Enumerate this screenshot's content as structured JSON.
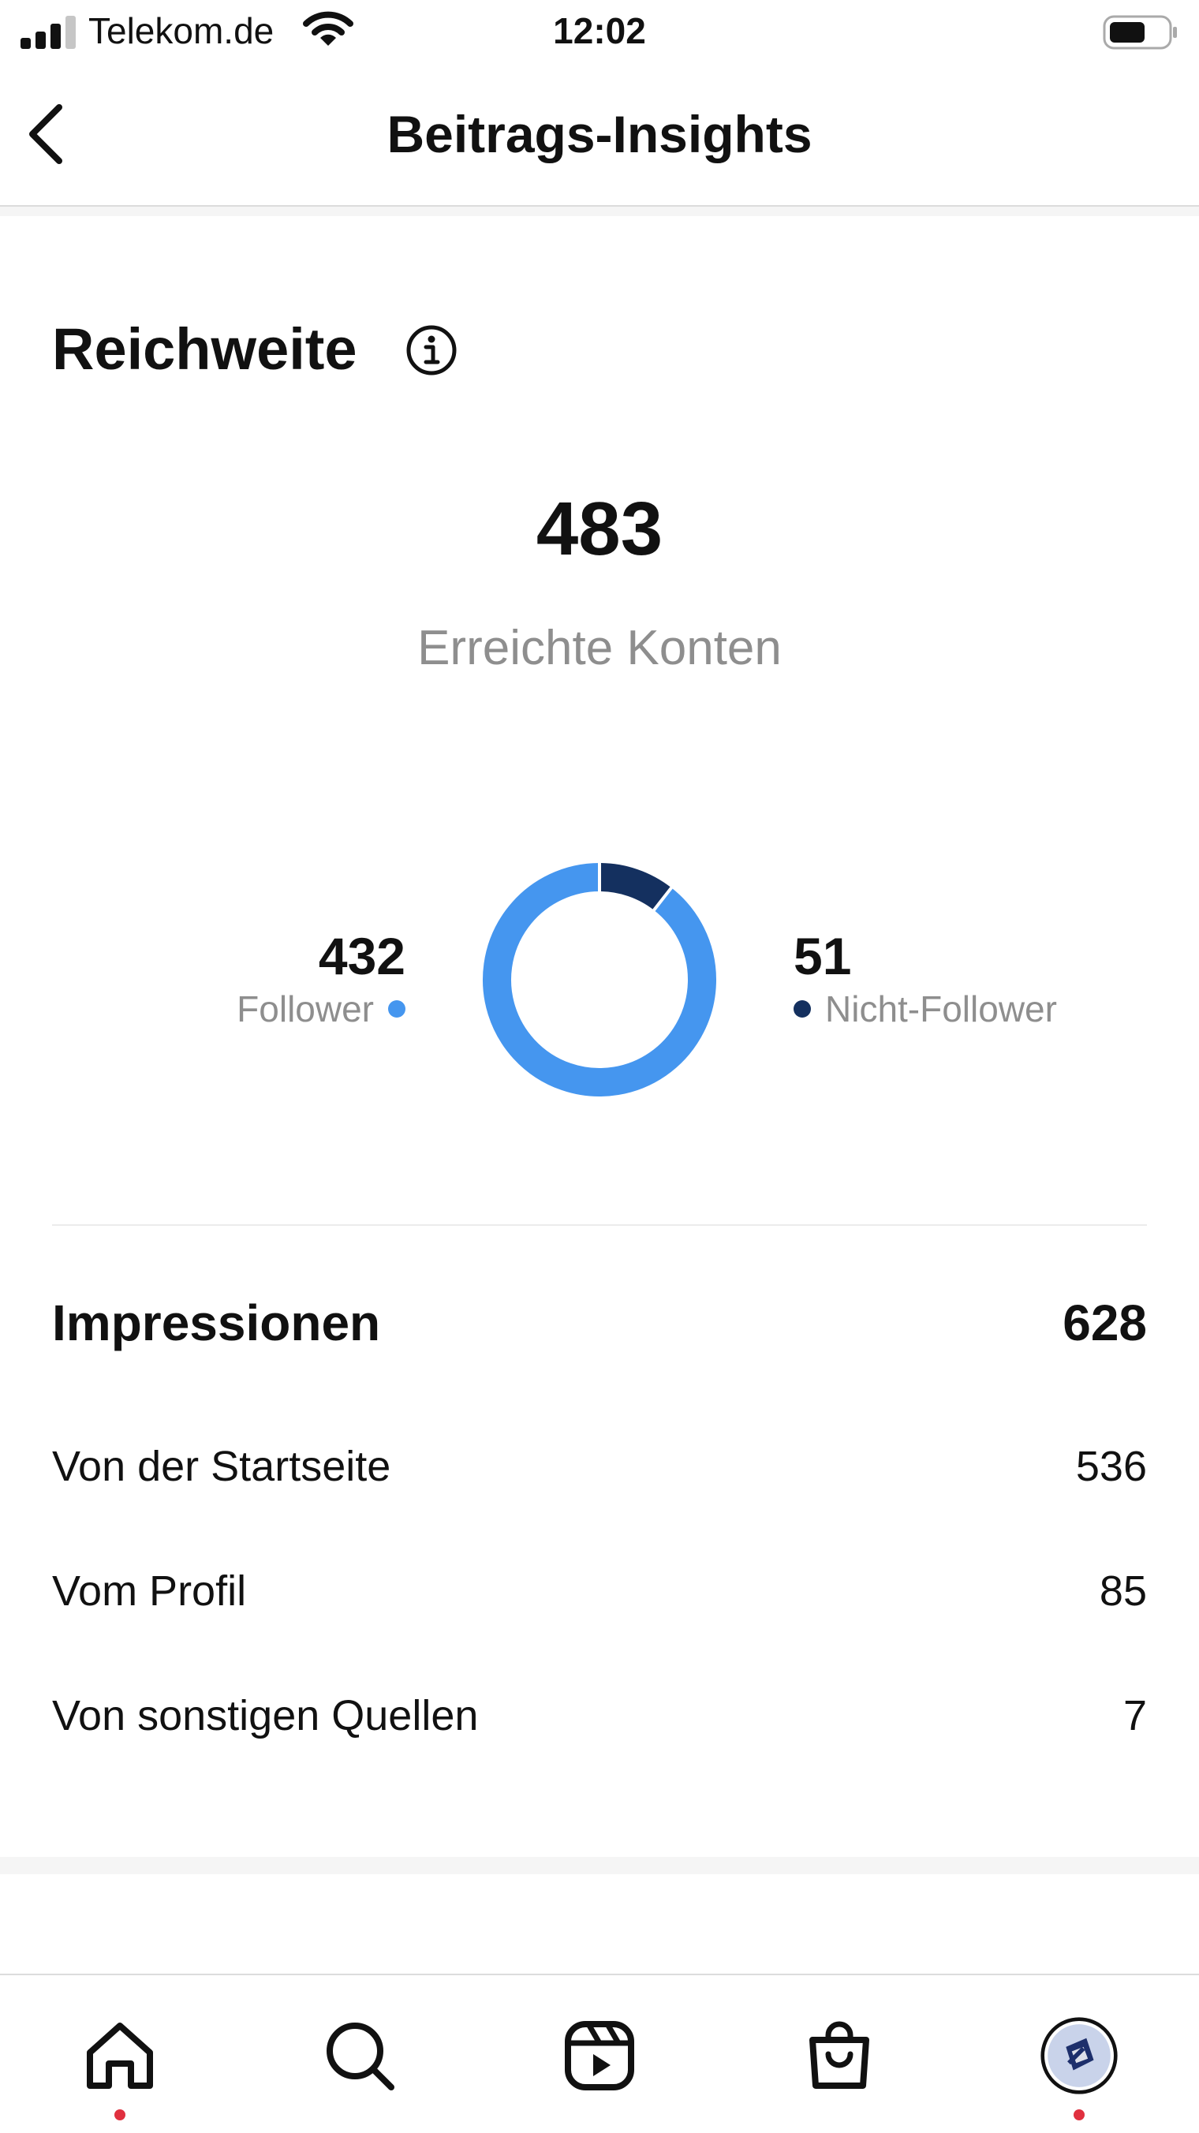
{
  "status_bar": {
    "carrier": "Telekom.de",
    "time": "12:02"
  },
  "header": {
    "title": "Beitrags-Insights"
  },
  "reach": {
    "title": "Reichweite",
    "accounts_reached": "483",
    "accounts_reached_label": "Erreichte Konten",
    "followers_value": "432",
    "followers_label": "Follower",
    "non_followers_value": "51",
    "non_followers_label": "Nicht-Follower"
  },
  "chart_data": {
    "type": "pie",
    "categories": [
      "Follower",
      "Nicht-Follower"
    ],
    "values": [
      432,
      51
    ],
    "colors": [
      "#4596ef",
      "#14305f"
    ]
  },
  "impressions": {
    "title": "Impressionen",
    "total": "628",
    "rows": [
      {
        "label": "Von der Startseite",
        "value": "536"
      },
      {
        "label": "Vom Profil",
        "value": "85"
      },
      {
        "label": "Von sonstigen Quellen",
        "value": "7"
      }
    ]
  },
  "tab_bar": {
    "items": [
      {
        "icon": "home-icon",
        "notification": true
      },
      {
        "icon": "search-icon",
        "notification": false
      },
      {
        "icon": "reels-icon",
        "notification": false
      },
      {
        "icon": "shop-icon",
        "notification": false
      },
      {
        "icon": "profile-avatar",
        "notification": true
      }
    ]
  },
  "colors": {
    "follower": "#4596ef",
    "non_follower": "#14305f",
    "notification": "#e0303f",
    "muted_text": "#8e8e8e"
  }
}
